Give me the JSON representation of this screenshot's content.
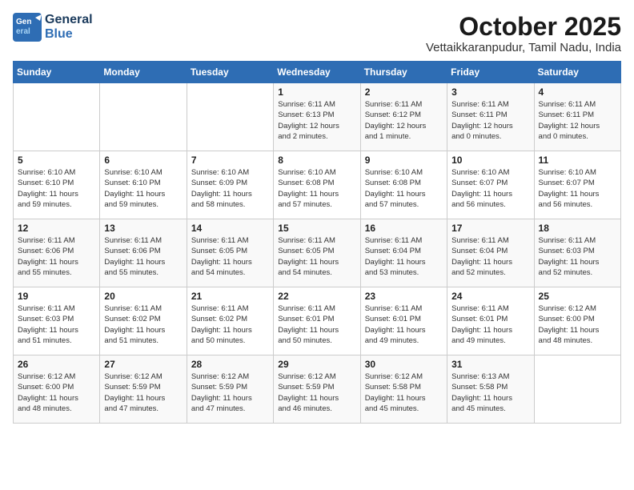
{
  "header": {
    "logo_general": "General",
    "logo_blue": "Blue",
    "month": "October 2025",
    "location": "Vettaikkaranpudur, Tamil Nadu, India"
  },
  "days_of_week": [
    "Sunday",
    "Monday",
    "Tuesday",
    "Wednesday",
    "Thursday",
    "Friday",
    "Saturday"
  ],
  "weeks": [
    [
      {
        "day": "",
        "info": ""
      },
      {
        "day": "",
        "info": ""
      },
      {
        "day": "",
        "info": ""
      },
      {
        "day": "1",
        "info": "Sunrise: 6:11 AM\nSunset: 6:13 PM\nDaylight: 12 hours\nand 2 minutes."
      },
      {
        "day": "2",
        "info": "Sunrise: 6:11 AM\nSunset: 6:12 PM\nDaylight: 12 hours\nand 1 minute."
      },
      {
        "day": "3",
        "info": "Sunrise: 6:11 AM\nSunset: 6:11 PM\nDaylight: 12 hours\nand 0 minutes."
      },
      {
        "day": "4",
        "info": "Sunrise: 6:11 AM\nSunset: 6:11 PM\nDaylight: 12 hours\nand 0 minutes."
      }
    ],
    [
      {
        "day": "5",
        "info": "Sunrise: 6:10 AM\nSunset: 6:10 PM\nDaylight: 11 hours\nand 59 minutes."
      },
      {
        "day": "6",
        "info": "Sunrise: 6:10 AM\nSunset: 6:10 PM\nDaylight: 11 hours\nand 59 minutes."
      },
      {
        "day": "7",
        "info": "Sunrise: 6:10 AM\nSunset: 6:09 PM\nDaylight: 11 hours\nand 58 minutes."
      },
      {
        "day": "8",
        "info": "Sunrise: 6:10 AM\nSunset: 6:08 PM\nDaylight: 11 hours\nand 57 minutes."
      },
      {
        "day": "9",
        "info": "Sunrise: 6:10 AM\nSunset: 6:08 PM\nDaylight: 11 hours\nand 57 minutes."
      },
      {
        "day": "10",
        "info": "Sunrise: 6:10 AM\nSunset: 6:07 PM\nDaylight: 11 hours\nand 56 minutes."
      },
      {
        "day": "11",
        "info": "Sunrise: 6:10 AM\nSunset: 6:07 PM\nDaylight: 11 hours\nand 56 minutes."
      }
    ],
    [
      {
        "day": "12",
        "info": "Sunrise: 6:11 AM\nSunset: 6:06 PM\nDaylight: 11 hours\nand 55 minutes."
      },
      {
        "day": "13",
        "info": "Sunrise: 6:11 AM\nSunset: 6:06 PM\nDaylight: 11 hours\nand 55 minutes."
      },
      {
        "day": "14",
        "info": "Sunrise: 6:11 AM\nSunset: 6:05 PM\nDaylight: 11 hours\nand 54 minutes."
      },
      {
        "day": "15",
        "info": "Sunrise: 6:11 AM\nSunset: 6:05 PM\nDaylight: 11 hours\nand 54 minutes."
      },
      {
        "day": "16",
        "info": "Sunrise: 6:11 AM\nSunset: 6:04 PM\nDaylight: 11 hours\nand 53 minutes."
      },
      {
        "day": "17",
        "info": "Sunrise: 6:11 AM\nSunset: 6:04 PM\nDaylight: 11 hours\nand 52 minutes."
      },
      {
        "day": "18",
        "info": "Sunrise: 6:11 AM\nSunset: 6:03 PM\nDaylight: 11 hours\nand 52 minutes."
      }
    ],
    [
      {
        "day": "19",
        "info": "Sunrise: 6:11 AM\nSunset: 6:03 PM\nDaylight: 11 hours\nand 51 minutes."
      },
      {
        "day": "20",
        "info": "Sunrise: 6:11 AM\nSunset: 6:02 PM\nDaylight: 11 hours\nand 51 minutes."
      },
      {
        "day": "21",
        "info": "Sunrise: 6:11 AM\nSunset: 6:02 PM\nDaylight: 11 hours\nand 50 minutes."
      },
      {
        "day": "22",
        "info": "Sunrise: 6:11 AM\nSunset: 6:01 PM\nDaylight: 11 hours\nand 50 minutes."
      },
      {
        "day": "23",
        "info": "Sunrise: 6:11 AM\nSunset: 6:01 PM\nDaylight: 11 hours\nand 49 minutes."
      },
      {
        "day": "24",
        "info": "Sunrise: 6:11 AM\nSunset: 6:01 PM\nDaylight: 11 hours\nand 49 minutes."
      },
      {
        "day": "25",
        "info": "Sunrise: 6:12 AM\nSunset: 6:00 PM\nDaylight: 11 hours\nand 48 minutes."
      }
    ],
    [
      {
        "day": "26",
        "info": "Sunrise: 6:12 AM\nSunset: 6:00 PM\nDaylight: 11 hours\nand 48 minutes."
      },
      {
        "day": "27",
        "info": "Sunrise: 6:12 AM\nSunset: 5:59 PM\nDaylight: 11 hours\nand 47 minutes."
      },
      {
        "day": "28",
        "info": "Sunrise: 6:12 AM\nSunset: 5:59 PM\nDaylight: 11 hours\nand 47 minutes."
      },
      {
        "day": "29",
        "info": "Sunrise: 6:12 AM\nSunset: 5:59 PM\nDaylight: 11 hours\nand 46 minutes."
      },
      {
        "day": "30",
        "info": "Sunrise: 6:12 AM\nSunset: 5:58 PM\nDaylight: 11 hours\nand 45 minutes."
      },
      {
        "day": "31",
        "info": "Sunrise: 6:13 AM\nSunset: 5:58 PM\nDaylight: 11 hours\nand 45 minutes."
      },
      {
        "day": "",
        "info": ""
      }
    ]
  ]
}
